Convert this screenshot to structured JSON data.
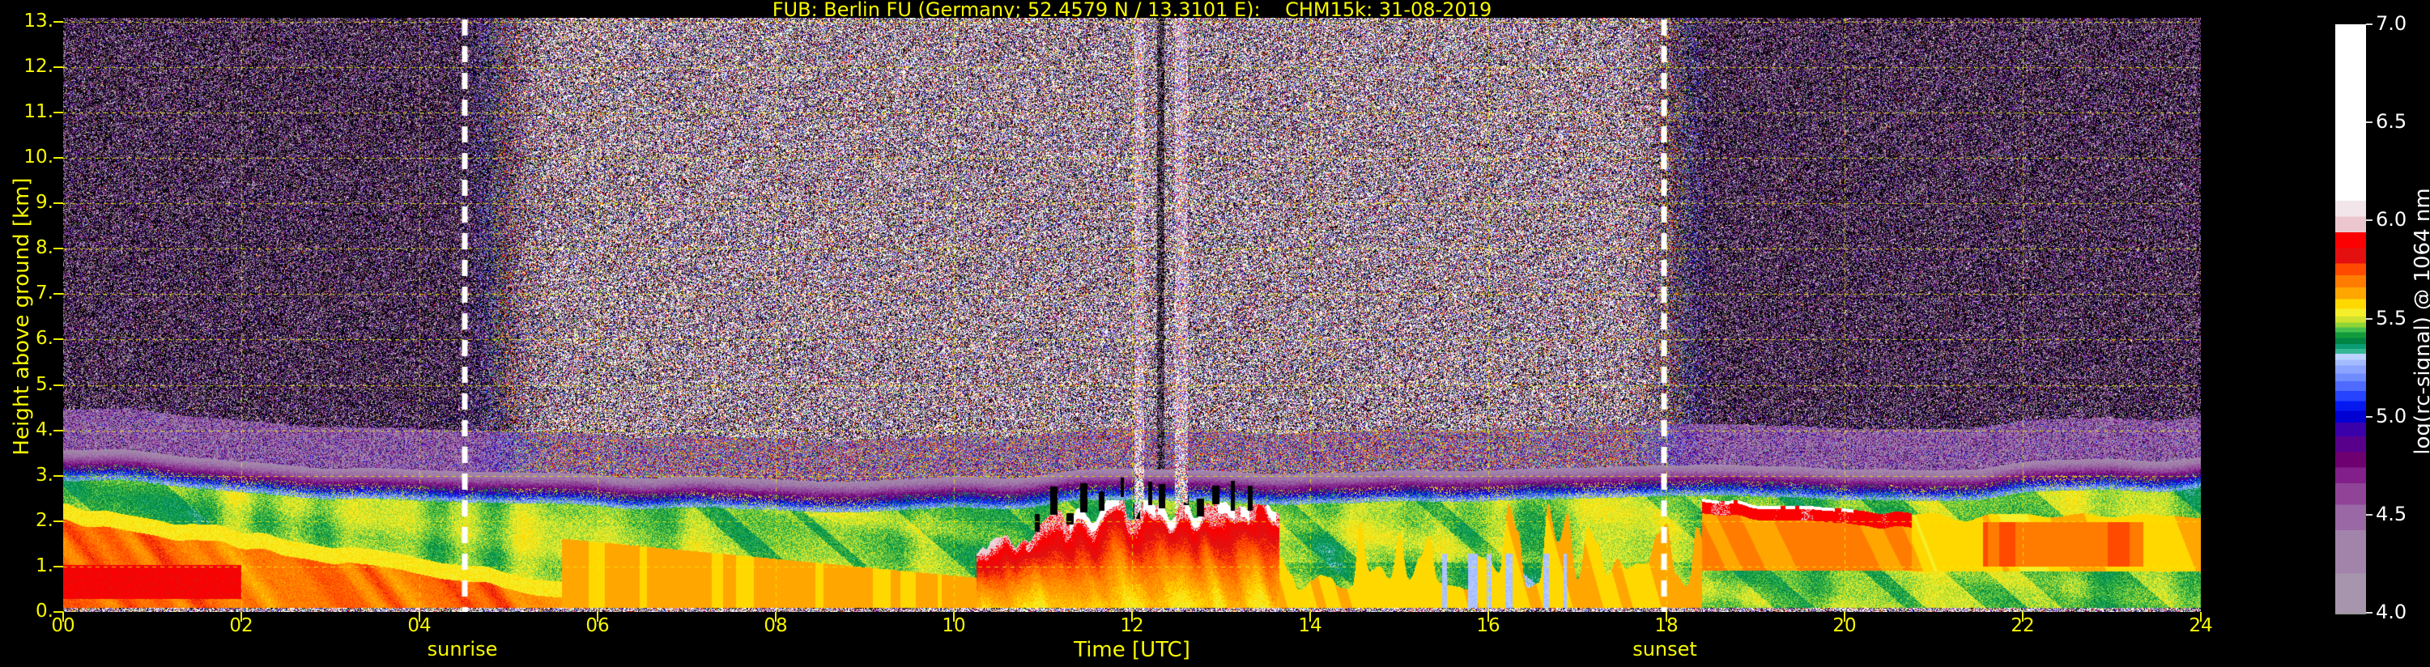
{
  "title": "FUB: Berlin FU (Germany; 52.4579 N / 13.3101 E):    CHM15k: 31-08-2019",
  "colors": {
    "background": "#000000",
    "axis_text": "#f8f800",
    "grid": "#f0f000",
    "colorbar_text": "#ffffff",
    "sun_lines": "#ffffff"
  },
  "chart_data": {
    "type": "heatmap",
    "title": "FUB: Berlin FU (Germany; 52.4579 N / 13.3101 E):    CHM15k: 31-08-2019",
    "xlabel": "Time [UTC]",
    "ylabel": "Height above ground [km]",
    "xlim": [
      0,
      24
    ],
    "ylim": [
      0,
      13.08
    ],
    "grid": true,
    "x_ticks": [
      "00",
      "02",
      "04",
      "06",
      "08",
      "10",
      "12",
      "14",
      "16",
      "18",
      "20",
      "22",
      "24"
    ],
    "x_tick_hours": [
      0,
      2,
      4,
      6,
      8,
      10,
      12,
      14,
      16,
      18,
      20,
      22,
      24
    ],
    "y_ticks": [
      "13.",
      "12.",
      "11.",
      "10.",
      "9.",
      "8.",
      "7.",
      "6.",
      "5.",
      "4.",
      "3.",
      "2.",
      "1.",
      "0."
    ],
    "y_tick_km": [
      13,
      12,
      11,
      10,
      9,
      8,
      7,
      6,
      5,
      4,
      3,
      2,
      1,
      0
    ],
    "annotations": [
      {
        "label": "sunrise",
        "hour": 4.51,
        "style": "white-dashed-vertical-line"
      },
      {
        "label": "sunset",
        "hour": 17.97,
        "style": "white-dashed-vertical-line"
      }
    ],
    "colorbar": {
      "label": "log(rc-signal) @ 1064 nm",
      "ticks": [
        "4.0",
        "4.5",
        "5.0",
        "5.5",
        "6.0",
        "6.5",
        "7.0"
      ],
      "tick_values": [
        4.0,
        4.5,
        5.0,
        5.5,
        6.0,
        6.5,
        7.0
      ],
      "range": [
        4.0,
        7.0
      ],
      "under_color": "#000000",
      "bands": [
        {
          "from": 4.0,
          "to": 4.2,
          "color": "#a795ad"
        },
        {
          "from": 4.2,
          "to": 4.42,
          "color": "#a284ab"
        },
        {
          "from": 4.42,
          "to": 4.55,
          "color": "#9a68a4"
        },
        {
          "from": 4.55,
          "to": 4.66,
          "color": "#8f4498"
        },
        {
          "from": 4.66,
          "to": 4.74,
          "color": "#831f8a"
        },
        {
          "from": 4.74,
          "to": 4.82,
          "color": "#6e0070"
        },
        {
          "from": 4.82,
          "to": 4.9,
          "color": "#58008c"
        },
        {
          "from": 4.9,
          "to": 4.97,
          "color": "#3a00aa"
        },
        {
          "from": 4.97,
          "to": 5.03,
          "color": "#0000d2"
        },
        {
          "from": 5.03,
          "to": 5.08,
          "color": "#0618f0"
        },
        {
          "from": 5.08,
          "to": 5.13,
          "color": "#2644ff"
        },
        {
          "from": 5.13,
          "to": 5.18,
          "color": "#4e6aff"
        },
        {
          "from": 5.18,
          "to": 5.22,
          "color": "#6f8cff"
        },
        {
          "from": 5.22,
          "to": 5.26,
          "color": "#8aa4ff"
        },
        {
          "from": 5.26,
          "to": 5.29,
          "color": "#a4bcff"
        },
        {
          "from": 5.29,
          "to": 5.32,
          "color": "#bcd2ff"
        },
        {
          "from": 5.32,
          "to": 5.345,
          "color": "#35b796"
        },
        {
          "from": 5.345,
          "to": 5.37,
          "color": "#0c9c74"
        },
        {
          "from": 5.37,
          "to": 5.4,
          "color": "#008544"
        },
        {
          "from": 5.4,
          "to": 5.43,
          "color": "#129b3c"
        },
        {
          "from": 5.43,
          "to": 5.455,
          "color": "#46bf4e"
        },
        {
          "from": 5.455,
          "to": 5.48,
          "color": "#8fd437"
        },
        {
          "from": 5.48,
          "to": 5.51,
          "color": "#cfe32e"
        },
        {
          "from": 5.51,
          "to": 5.55,
          "color": "#f4ef2a"
        },
        {
          "from": 5.55,
          "to": 5.6,
          "color": "#ffd800"
        },
        {
          "from": 5.6,
          "to": 5.66,
          "color": "#ffa600"
        },
        {
          "from": 5.66,
          "to": 5.72,
          "color": "#ff7c00"
        },
        {
          "from": 5.72,
          "to": 5.78,
          "color": "#ff4a00"
        },
        {
          "from": 5.78,
          "to": 5.86,
          "color": "#e41010"
        },
        {
          "from": 5.86,
          "to": 5.94,
          "color": "#fa0000"
        },
        {
          "from": 5.94,
          "to": 6.02,
          "color": "#ecc6ce"
        },
        {
          "from": 6.02,
          "to": 6.1,
          "color": "#f2e6ea"
        },
        {
          "from": 6.1,
          "to": 7.0,
          "color": "#ffffff"
        }
      ]
    },
    "features": {
      "description": "Daytime bright salt-and-pepper noise aloft between sunrise and sunset; dark purple noise at night; aerosol boundary layer below ~3 km with blue transition band at layer top; surface speckle row.",
      "sunrise_hour": 4.51,
      "sunset_hour": 17.97,
      "layer_top_km": [
        [
          0,
          3.5
        ],
        [
          1.5,
          3.3
        ],
        [
          3,
          3.1
        ],
        [
          5,
          2.95
        ],
        [
          7,
          2.85
        ],
        [
          9,
          2.75
        ],
        [
          10.5,
          2.85
        ],
        [
          12,
          3.05
        ],
        [
          13.5,
          3.0
        ],
        [
          15,
          2.95
        ],
        [
          16.5,
          3.0
        ],
        [
          18,
          3.1
        ],
        [
          19.5,
          3.15
        ],
        [
          21,
          3.1
        ],
        [
          22.5,
          3.2
        ],
        [
          24,
          3.3
        ]
      ],
      "blue_band_width_km": 0.68,
      "night_low_band": {
        "t0": 0.0,
        "t1": 5.6,
        "top0": 1.95,
        "slope": -0.3,
        "value": 5.62,
        "core_value": 5.84
      },
      "morning_wedge": {
        "t0": 5.6,
        "t1": 10.25,
        "top0": 1.62,
        "slope": -0.185,
        "value": 5.56
      },
      "midday_plumes": {
        "t0": 10.2,
        "t1": 13.65,
        "top_max": 2.25,
        "value": 5.52,
        "red_span": 0.42,
        "cap_value": 6.15,
        "n_dark_spikes": 14
      },
      "afternoon": {
        "t0": 13.65,
        "t1": 18.4,
        "value": 5.4,
        "spike_value": 5.55
      },
      "evening_band": {
        "t0": 18.4,
        "t1": 20.75,
        "top0": 2.42,
        "slope": -0.13,
        "thickness": 0.32,
        "value": 5.85,
        "cap_value": 6.12
      },
      "late_layer": {
        "t0": 20.75,
        "t1": 24.0,
        "bottom": 0.9,
        "top": 2.0,
        "value": 5.54,
        "orange_t0": 21.55,
        "orange_t1": 23.35,
        "orange_value": 5.67
      },
      "white_streak_hours": [
        [
          12.02,
          12.13
        ],
        [
          12.48,
          12.62
        ]
      ],
      "dark_streak_hours": [
        [
          12.28,
          12.36
        ]
      ],
      "surface_speckle_km": 0.1
    }
  }
}
